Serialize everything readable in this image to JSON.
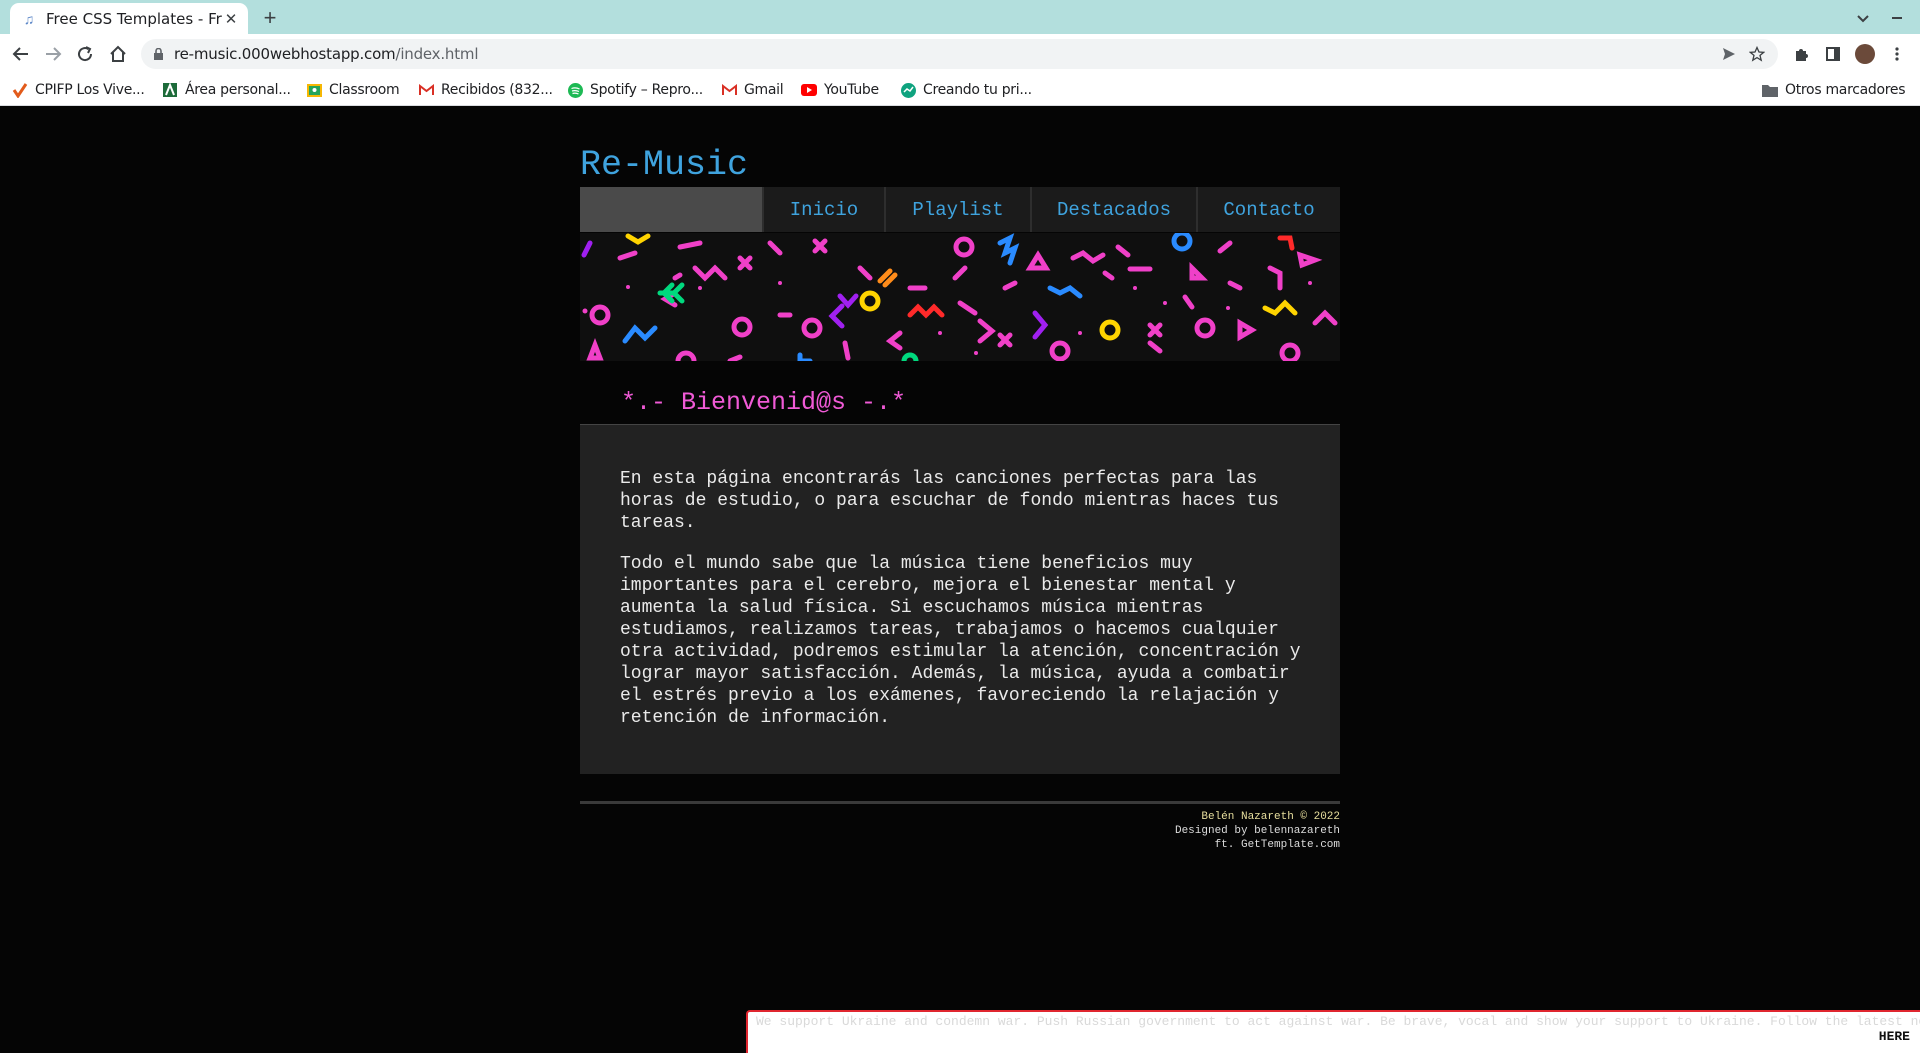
{
  "browser": {
    "tab_title": "Free CSS Templates - Free CSS Templates",
    "url_host": "re-music.000webhostapp.com",
    "url_path": "/index.html",
    "bookmarks": [
      {
        "label": "CPIFP Los Vive..."
      },
      {
        "label": "Área personal..."
      },
      {
        "label": "Classroom"
      },
      {
        "label": "Recibidos (832..."
      },
      {
        "label": "Spotify – Repro..."
      },
      {
        "label": "Gmail"
      },
      {
        "label": "YouTube"
      },
      {
        "label": "Creando tu pri..."
      }
    ],
    "other_bookmarks": "Otros marcadores"
  },
  "site": {
    "title": "Re-Music",
    "nav": [
      "Inicio",
      "Playlist",
      "Destacados",
      "Contacto"
    ],
    "heading": "*.- Bienvenid@s -.*",
    "paragraphs": [
      "En esta página encontrarás las canciones perfectas para las horas de estudio, o para escuchar de fondo mientras haces tus tareas.",
      "Todo el mundo sabe que la música tiene beneficios muy importantes para el cerebro, mejora el bienestar mental y aumenta la salud física. Si escuchamos música mientras estudiamos, realizamos tareas, trabajamos o hacemos cualquier otra actividad, podremos estimular la atención, concentración y lograr mayor satisfacción. Además, la música, ayuda a combatir el estrés previo a los exámenes, favoreciendo la relajación y retención de información."
    ],
    "footer": {
      "line1": "Belén Nazareth © 2022",
      "line2": "Designed by belennazareth",
      "line3": "ft. GetTemplate.com"
    }
  },
  "banner_bar": {
    "text": "We support Ukraine and condemn war. Push Russian government to act against war. Be brave, vocal and show your support to Ukraine. Follow the latest news",
    "link": "HERE"
  },
  "colors": {
    "accent_blue": "#3fa3de",
    "heading_pink": "#f05ad6",
    "page_bg": "#050505",
    "content_bg": "#222222"
  }
}
